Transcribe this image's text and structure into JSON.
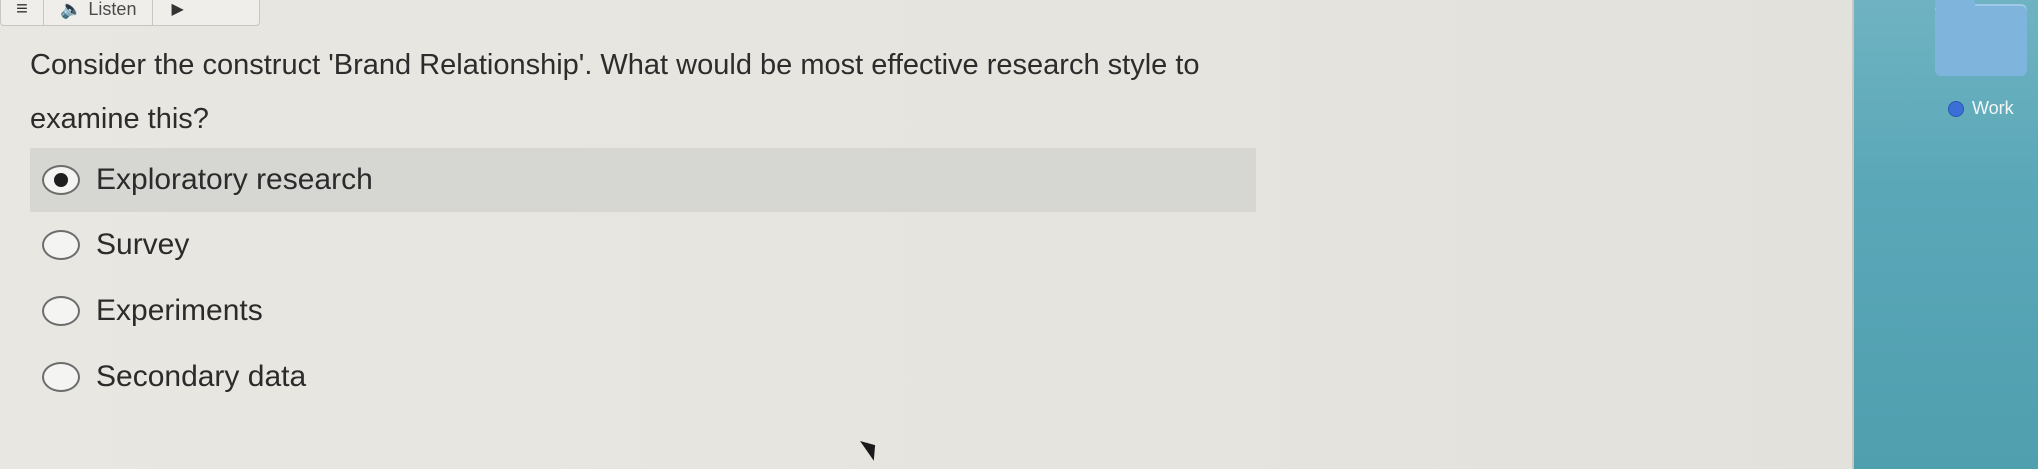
{
  "toolbar": {
    "menu_icon": "hamburger-icon",
    "listen_label": "Listen",
    "speaker_icon": "speaker-icon",
    "play_icon": "play-icon"
  },
  "question": {
    "text": "Consider the construct 'Brand Relationship'. What would be most effective research style to examine this?"
  },
  "options": [
    {
      "label": "Exploratory research",
      "selected": true
    },
    {
      "label": "Survey",
      "selected": false
    },
    {
      "label": "Experiments",
      "selected": false
    },
    {
      "label": "Secondary data",
      "selected": false
    }
  ],
  "desktop": {
    "folder_icon": "folder-icon",
    "tag_label": "Work",
    "tag_color": "#3b6fd6"
  }
}
